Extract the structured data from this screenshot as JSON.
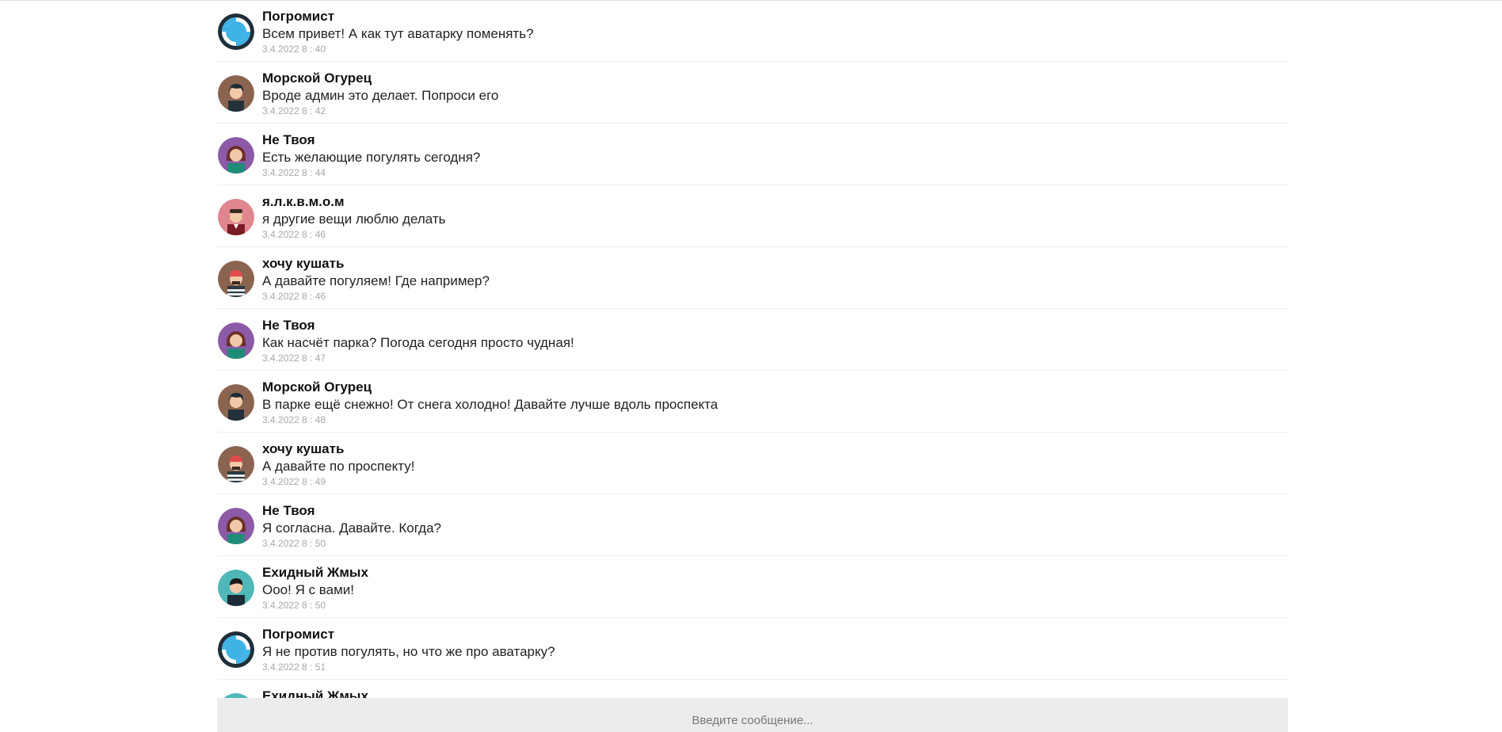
{
  "messages": [
    {
      "author": "Погромист",
      "text": "Всем привет! А как тут аватарку поменять?",
      "time": "3.4.2022 8 : 40",
      "avatar": "lifebuoy-icon"
    },
    {
      "author": "Морской Огурец",
      "text": "Вроде админ это делает. Попроси его",
      "time": "3.4.2022 8 : 42",
      "avatar": "person-dark-hair-icon"
    },
    {
      "author": "Не Твоя",
      "text": "Есть желающие погулять сегодня?",
      "time": "3.4.2022 8 : 44",
      "avatar": "woman-curly-hair-icon"
    },
    {
      "author": "я.л.к.в.м.о.м",
      "text": "я другие вещи люблю делать",
      "time": "3.4.2022 8 : 46",
      "avatar": "man-suit-icon"
    },
    {
      "author": "хочу кушать",
      "text": "А давайте погуляем! Где например?",
      "time": "3.4.2022 8 : 46",
      "avatar": "man-red-cap-icon"
    },
    {
      "author": "Не Твоя",
      "text": "Как насчёт парка? Погода сегодня просто чудная!",
      "time": "3.4.2022 8 : 47",
      "avatar": "woman-curly-hair-icon"
    },
    {
      "author": "Морской Огурец",
      "text": "В парке ещё снежно! От снега холодно! Давайте лучше вдоль проспекта",
      "time": "3.4.2022 8 : 48",
      "avatar": "person-dark-hair-icon"
    },
    {
      "author": "хочу кушать",
      "text": "А давайте по проспекту!",
      "time": "3.4.2022 8 : 49",
      "avatar": "man-red-cap-icon"
    },
    {
      "author": "Не Твоя",
      "text": "Я согласна. Давайте. Когда?",
      "time": "3.4.2022 8 : 50",
      "avatar": "woman-curly-hair-icon"
    },
    {
      "author": "Ехидный Жмых",
      "text": "Ооо! Я с вами!",
      "time": "3.4.2022 8 : 50",
      "avatar": "man-teal-icon"
    },
    {
      "author": "Погромист",
      "text": "Я не против погулять, но что же про аватарку?",
      "time": "3.4.2022 8 : 51",
      "avatar": "lifebuoy-icon"
    },
    {
      "author": "Ехидный Жмых",
      "text": "",
      "time": "",
      "avatar": "man-teal-icon"
    }
  ],
  "composer": {
    "placeholder": "Введите сообщение..."
  },
  "colors": {
    "avatar_brown": "#8b6450",
    "avatar_purple": "#8c5aa6",
    "avatar_pink": "#e0868f",
    "avatar_teal": "#4fb7b7",
    "avatar_blue": "#3fb3e6",
    "divider": "#ececec",
    "input_bg": "#ececec"
  }
}
